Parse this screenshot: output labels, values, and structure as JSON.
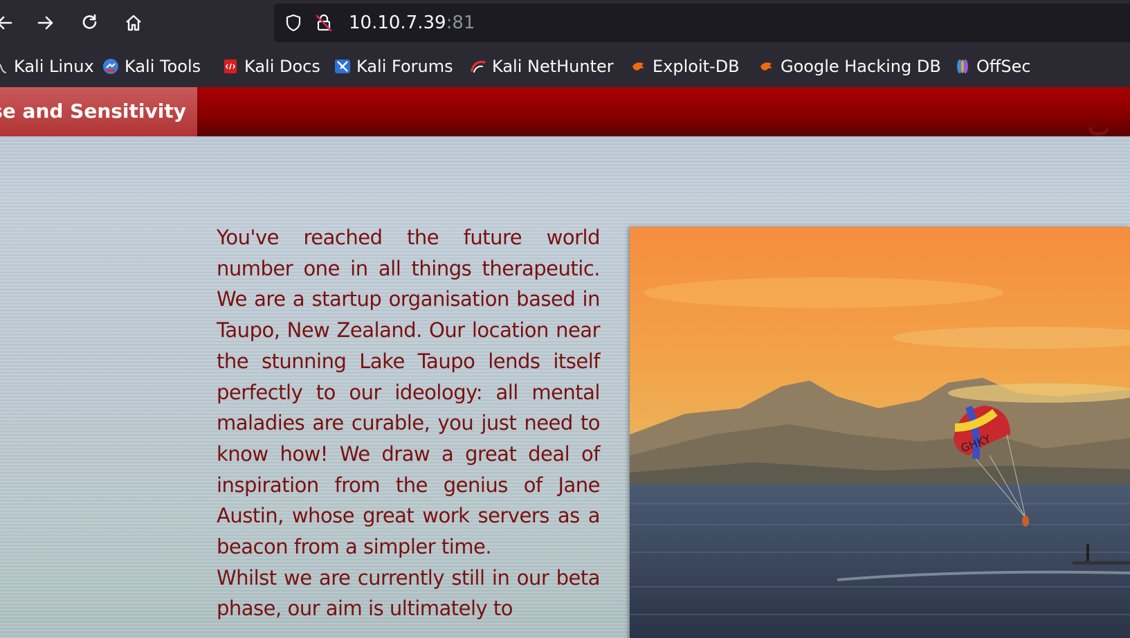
{
  "browser": {
    "url_host": "10.10.7.39",
    "url_port": ":81"
  },
  "bookmarks": [
    {
      "label": "Kali Linux",
      "icon": "kali-dragon-icon"
    },
    {
      "label": "Kali Tools",
      "icon": "kali-tools-icon"
    },
    {
      "label": "Kali Docs",
      "icon": "kali-docs-icon"
    },
    {
      "label": "Kali Forums",
      "icon": "kali-forums-icon"
    },
    {
      "label": "Kali NetHunter",
      "icon": "kali-nethunter-icon"
    },
    {
      "label": "Exploit-DB",
      "icon": "exploit-db-icon"
    },
    {
      "label": "Google Hacking DB",
      "icon": "google-hacking-db-icon"
    },
    {
      "label": "OffSec",
      "icon": "offsec-icon"
    }
  ],
  "site": {
    "nav_active_label": "ense and Sensitivity",
    "intro_paragraphs": [
      "You've reached the future world number one in all things therapeutic. We are a startup organisation based in Taupo, New Zealand. Our location near the stunning Lake Taupo lends itself perfectly to our ideology: all mental maladies are curable, you just need to know how! We draw a great deal of inspiration from the genius of Jane Austin, whose great work servers as a beacon from a simpler time.",
      "Whilst we are currently still in our beta phase, our aim is ultimately to"
    ],
    "photo_parachute_text": "GHKY"
  },
  "colors": {
    "accent_red": "#a80000",
    "body_text": "#7a1010",
    "toolbar_bg": "#2b2a33"
  }
}
